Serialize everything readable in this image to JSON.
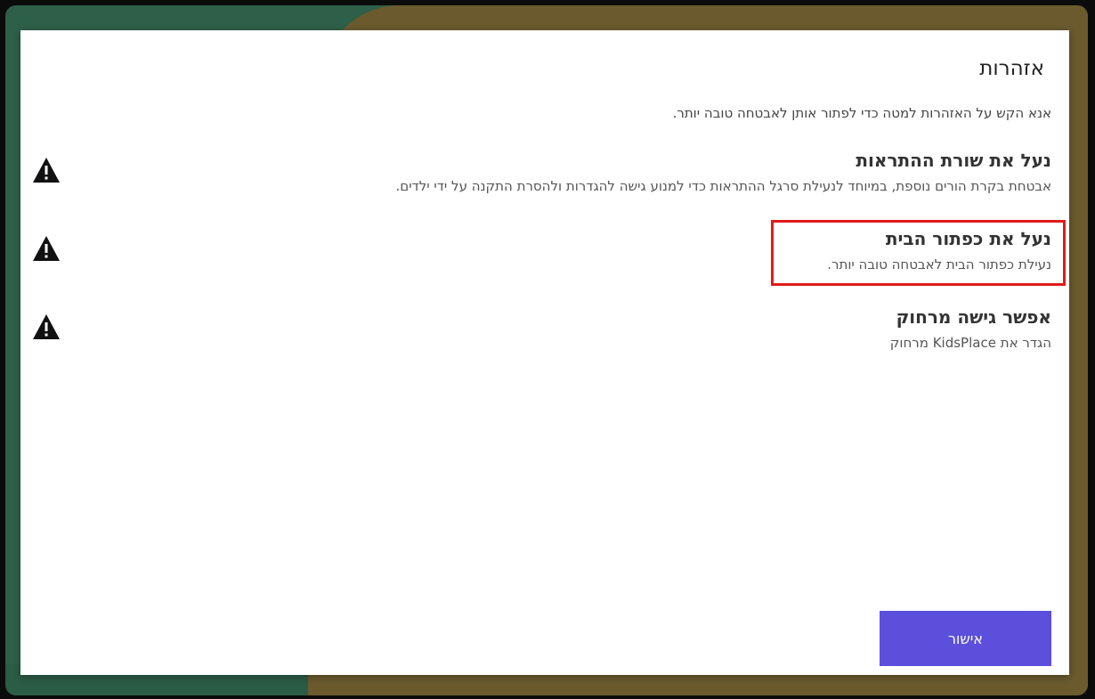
{
  "dialog": {
    "title": "אזהרות",
    "instruction": "אנא הקש על האזהרות למטה כדי לפתור אותן לאבטחה טובה יותר.",
    "warnings": [
      {
        "title": "נעל את שורת ההתראות",
        "description": "אבטחת בקרת הורים נוספת, במיוחד לנעילת סרגל ההתראות כדי למנוע גישה להגדרות ולהסרת התקנה על ידי ילדים.",
        "icon": "warning-icon"
      },
      {
        "title": "נעל את כפתור הבית",
        "description": "נעילת כפתור הבית לאבטחה טובה יותר.",
        "icon": "warning-icon"
      },
      {
        "title": "אפשר גישה מרחוק",
        "description": "הגדר את KidsPlace מרחוק",
        "icon": "warning-icon"
      }
    ],
    "ok_button": "אישור"
  },
  "colors": {
    "accent": "#5b4fdc",
    "highlight": "#e01b1b"
  }
}
